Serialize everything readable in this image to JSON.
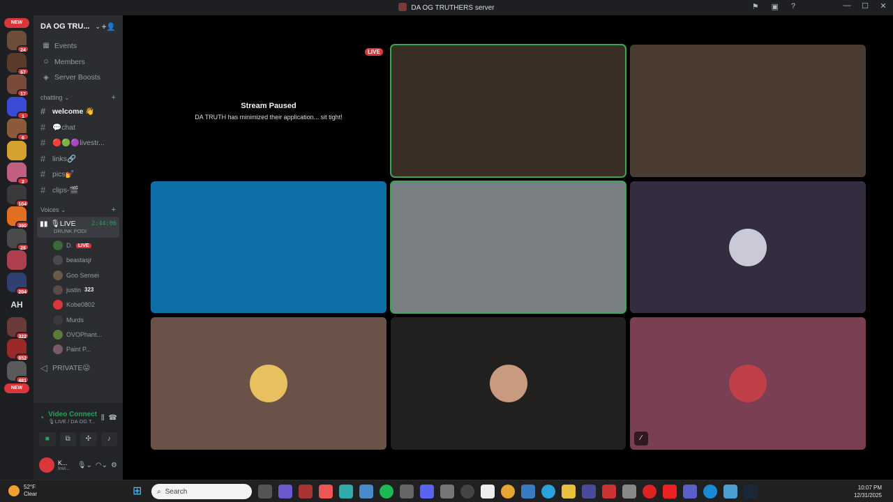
{
  "window": {
    "title": "DA OG TRUTHERS server",
    "controls": [
      "minimize-icon",
      "maximize-icon",
      "close-icon"
    ]
  },
  "guilds": {
    "items": [
      {
        "badge": "24",
        "color": "#6a4e3a"
      },
      {
        "badge": "67",
        "color": "#5a3a2a"
      },
      {
        "badge": "17",
        "color": "#7a4a3a"
      },
      {
        "badge": "1",
        "color": "#3b4bd8"
      },
      {
        "badge": "6",
        "color": "#8a5a3a"
      },
      {
        "badge": "",
        "color": "#d4a030"
      },
      {
        "badge": "2",
        "color": "#c06080"
      },
      {
        "badge": "104",
        "color": "#3a3a3a"
      },
      {
        "badge": "360",
        "color": "#e07020"
      },
      {
        "badge": "28",
        "color": "#4a4a4a"
      },
      {
        "badge": "",
        "color": "#b04050"
      },
      {
        "badge": "204",
        "color": "#304070"
      }
    ],
    "new_label_top": "NEW",
    "text_guild": "AH",
    "items_lower": [
      {
        "badge": "322",
        "color": "#6a3a3a"
      },
      {
        "badge": "852",
        "color": "#9a2a2a"
      },
      {
        "badge": "481",
        "color": "#5a5a5a"
      }
    ],
    "new_label_bottom": "NEW"
  },
  "sidebar": {
    "server_name": "DA OG TRU...",
    "nav": [
      {
        "label": "Events",
        "icon": "calendar-icon"
      },
      {
        "label": "Members",
        "icon": "members-icon"
      },
      {
        "label": "Server Boosts",
        "icon": "boost-icon"
      }
    ],
    "category_chatting": "chatting",
    "channels": [
      {
        "label": "welcome 👋",
        "unread": true
      },
      {
        "label": "💬chat",
        "unread": false
      },
      {
        "label": "🔴🟢🟣livestr...",
        "unread": false
      },
      {
        "label": "links🔗",
        "unread": false
      },
      {
        "label": "pics💅",
        "unread": false
      },
      {
        "label": "clips-🎬",
        "unread": false
      }
    ],
    "category_voices": "Voices",
    "live_channel": {
      "label": "🎙LIVE",
      "timer": "2:44:06",
      "activity": "DRUNK PODI"
    },
    "voice_users": [
      {
        "name": "D.",
        "tag": "LIVE",
        "color": "#3a6a3a"
      },
      {
        "name": "beastasjr",
        "tag": "",
        "color": "#4a4a4a"
      },
      {
        "name": "Goo Sensei",
        "tag": "",
        "color": "#6a5a4a"
      },
      {
        "name": "justin",
        "tag": "",
        "tagnum": "323",
        "color": "#5a4a4a"
      },
      {
        "name": "Kobe0802",
        "tag": "",
        "color": "#da373c"
      },
      {
        "name": "Murds",
        "tag": "",
        "color": "#3a3a3a"
      },
      {
        "name": "OVOPhant...",
        "tag": "",
        "color": "#5a7a3a"
      },
      {
        "name": "Paint P...",
        "tag": "",
        "color": "#7a5a6a"
      }
    ],
    "private_channel": "PRIVATE😛"
  },
  "panel": {
    "status": "Video Connected",
    "location": "🎙LIVE / DA OG T...",
    "user_name": "K...",
    "user_status": "Invi..."
  },
  "stage": {
    "paused_title": "Stream Paused",
    "paused_sub": "DA TRUTH has minimized their application... sit tight!",
    "live_label": "LIVE",
    "tiles": [
      {
        "bg": "#000000"
      },
      {
        "bg": "#3a2e24"
      },
      {
        "bg": "#4a3c30"
      },
      {
        "bg": "#0e6fa8"
      },
      {
        "bg": "#7a7f84"
      },
      {
        "bg": "#342d3f"
      },
      {
        "bg": "#6a5248"
      },
      {
        "bg": "#221f1f"
      },
      {
        "bg": "#7a3f52"
      }
    ]
  },
  "taskbar": {
    "temp": "52°F",
    "condition": "Clear",
    "search_placeholder": "Search",
    "time": "10:07 PM",
    "date": "12/31/2025"
  }
}
